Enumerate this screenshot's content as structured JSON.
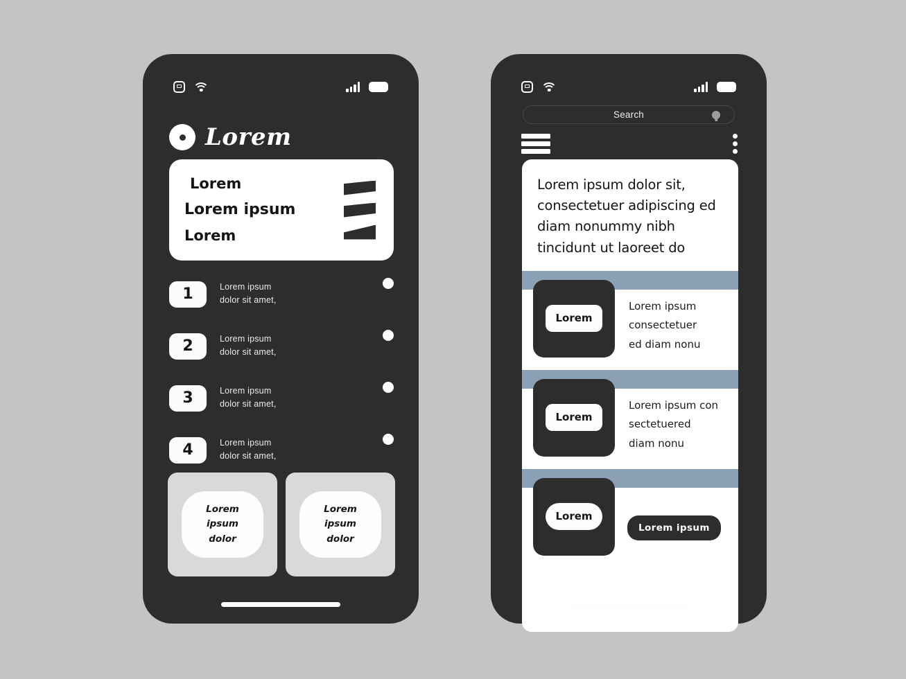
{
  "canvas": {
    "background_color": "#c4c4c4",
    "device_color": "#2e2d2d",
    "accent_color": "#8b9fb5"
  },
  "status_bar": {
    "app_icon": "app-icon",
    "wifi_icon": "wifi-icon",
    "signal_icon": "signal-icon",
    "battery_icon": "battery-icon"
  },
  "screen_one": {
    "logo": {
      "mark": "circle-dot-logo-icon",
      "text": "Lorem"
    },
    "hero_card": {
      "line1": "Lorem",
      "line2": "Lorem ipsum",
      "line3": "Lorem",
      "marks": [
        "slant-bar-1",
        "slant-bar-2",
        "slant-bar-3"
      ]
    },
    "list": [
      {
        "number": "1",
        "line1": "Lorem ipsum",
        "line2": "dolor sit amet,"
      },
      {
        "number": "2",
        "line1": "Lorem ipsum",
        "line2": "dolor sit amet,"
      },
      {
        "number": "3",
        "line1": "Lorem ipsum",
        "line2": "dolor sit amet,"
      },
      {
        "number": "4",
        "line1": "Lorem ipsum",
        "line2": "dolor sit amet,"
      }
    ],
    "bottom_cards": [
      {
        "line1": "Lorem",
        "line2": "ipsum",
        "line3": "dolor"
      },
      {
        "line1": "Lorem",
        "line2": "ipsum",
        "line3": "dolor"
      }
    ],
    "home_indicator": "home-indicator"
  },
  "screen_two": {
    "search": {
      "value": "Search",
      "placeholder": "Search",
      "icon": "search-icon"
    },
    "menu": {
      "hamburger": "hamburger-menu-icon",
      "kebab": "more-options-icon"
    },
    "panel": {
      "headline": "Lorem ipsum dolor sit, consectetuer adipiscing ed diam nonummy nibh tincidunt ut laoreet do",
      "rows": [
        {
          "thumb_label": "Lorem",
          "text_lines": [
            "Lorem ipsum",
            "consectetuer",
            "ed diam nonu"
          ],
          "cta": null
        },
        {
          "thumb_label": "Lorem",
          "text_lines": [
            "Lorem ipsum con",
            "sectetuered",
            "diam nonu"
          ],
          "cta": null
        },
        {
          "thumb_label": "Lorem",
          "text_lines": [],
          "cta": "Lorem ipsum"
        }
      ]
    },
    "home_indicator": "home-indicator"
  }
}
